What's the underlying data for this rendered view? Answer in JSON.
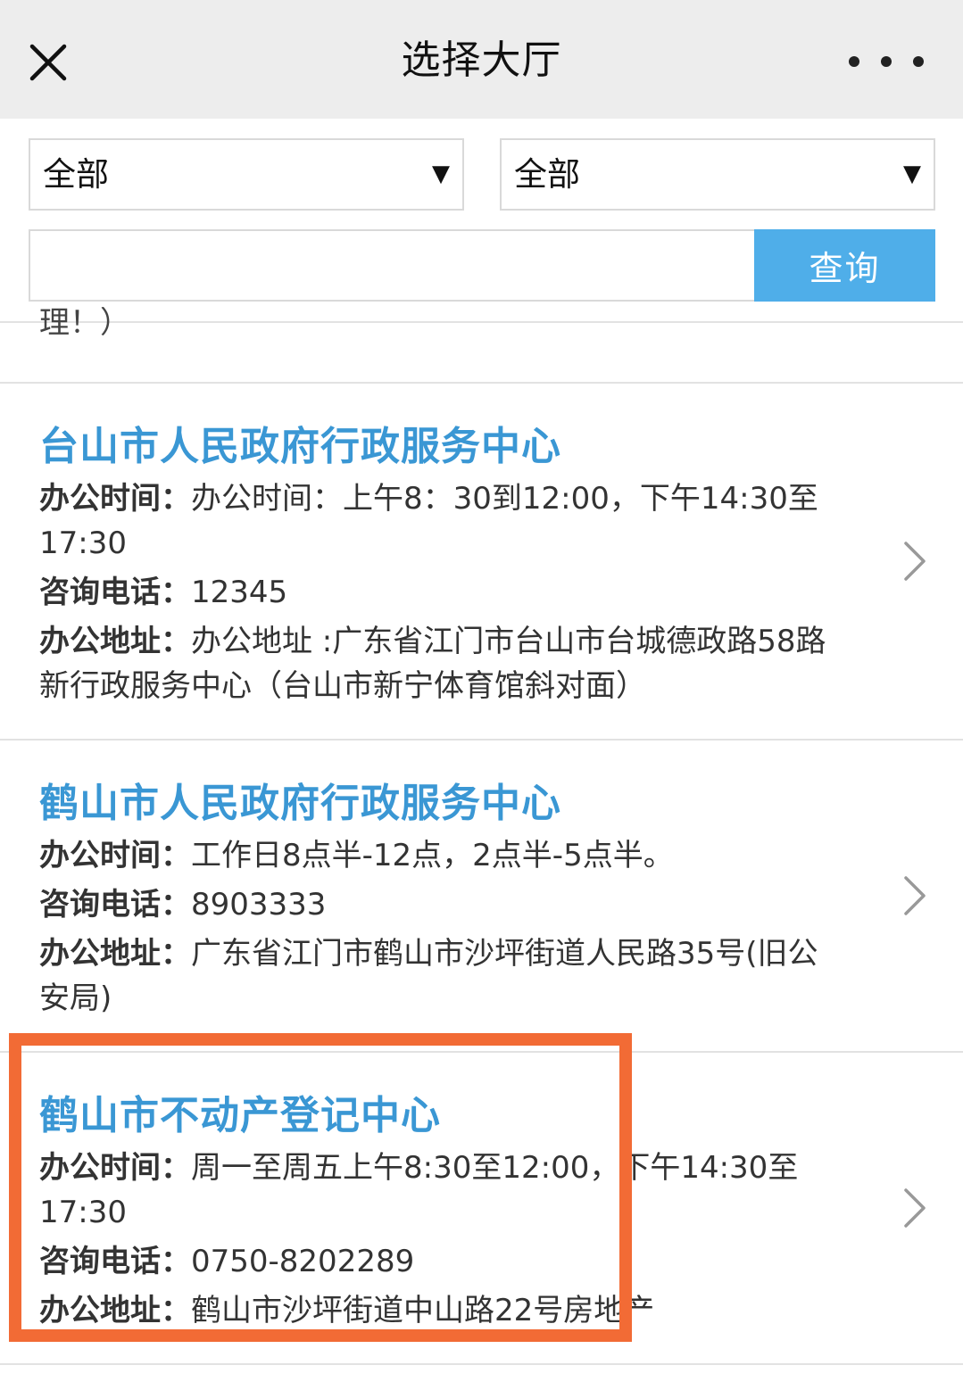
{
  "navbar": {
    "title": "选择大厅",
    "close_icon": "close-icon",
    "more_icon": "more-icon"
  },
  "filters": {
    "select1": {
      "value": "全部",
      "arrow": "▼"
    },
    "select2": {
      "value": "全部",
      "arrow": "▼"
    }
  },
  "search": {
    "placeholder": "",
    "button_label": "查询"
  },
  "partial_item": {
    "text": "理！）"
  },
  "halls": [
    {
      "name": "台山市人民政府行政服务中心",
      "hours_label": "办公时间：",
      "hours": "办公时间：上午8：30到12:00，下午14:30至17:30",
      "phone_label": "咨询电话：",
      "phone": "12345",
      "address_label": "办公地址：",
      "address": "办公地址 :广东省江门市台山市台城德政路58路新行政服务中心（台山市新宁体育馆斜对面）"
    },
    {
      "name": "鹤山市人民政府行政服务中心",
      "hours_label": "办公时间：",
      "hours": "工作日8点半-12点，2点半-5点半。",
      "phone_label": "咨询电话：",
      "phone": "8903333",
      "address_label": "办公地址：",
      "address": "广东省江门市鹤山市沙坪街道人民路35号(旧公安局)"
    },
    {
      "name": "鹤山市不动产登记中心",
      "hours_label": "办公时间：",
      "hours": "周一至周五上午8:30至12:00，下午14:30至17:30",
      "phone_label": "咨询电话：",
      "phone": "0750-8202289",
      "address_label": "办公地址：",
      "address": "鹤山市沙坪街道中山路22号房地产"
    }
  ],
  "colors": {
    "navbar_bg": "#ededed",
    "title_blue": "#3a97d4",
    "button_blue": "#4faee9",
    "highlight_orange": "#f26b35"
  }
}
